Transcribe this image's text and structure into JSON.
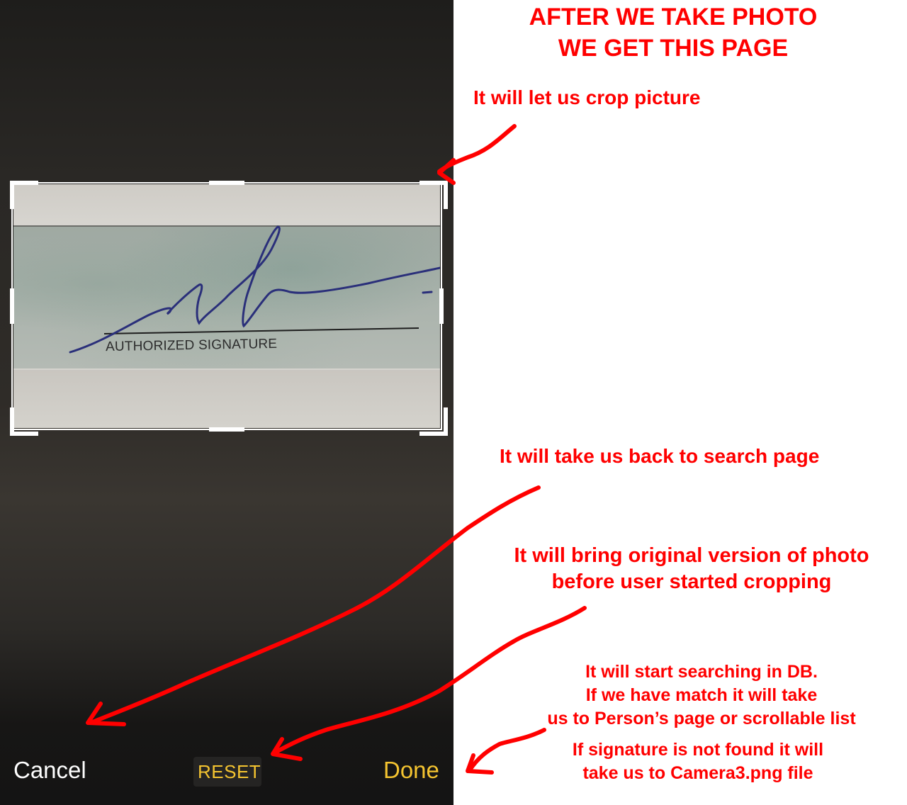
{
  "photo": {
    "printed_label": "AUTHORIZED SIGNATURE"
  },
  "toolbar": {
    "cancel_label": "Cancel",
    "reset_label": "RESET",
    "done_label": "Done"
  },
  "annotations": {
    "title": [
      "AFTER WE TAKE PHOTO",
      "WE GET THIS PAGE"
    ],
    "crop_note": "It will let us crop picture",
    "cancel_note": "It will take us back to search page",
    "reset_note": [
      "It will bring original version of photo",
      "before user started cropping"
    ],
    "done_note_search": [
      "It will start searching in DB.",
      "If we have match it will take",
      "us to Person’s page or scrollable list"
    ],
    "done_note_not_found": [
      "If signature is not found it will",
      "take us to Camera3.png file"
    ]
  },
  "colors": {
    "annotation": "#ff0000",
    "accent": "#f4c430",
    "dark_background": "#141414"
  }
}
